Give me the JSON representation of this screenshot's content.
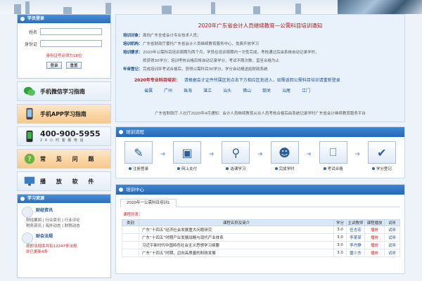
{
  "banner": {},
  "login": {
    "title": "学员登录",
    "name_label": "姓名",
    "id_label": "身份证",
    "name_value": "",
    "id_value": "",
    "hint": "身份证号必须为18位",
    "login_btn": "登录",
    "reset_btn": "重置"
  },
  "tiles": {
    "wechat": "手机微信学习指南",
    "app": "手机APP学习指南",
    "phone": "400-900-5955",
    "phone_sub": "2 4 小 时 客 服 电 话",
    "faq": "常 见 问 题",
    "player": "播 放 软 件"
  },
  "resources": {
    "title": "学习资源",
    "r1_title": "财经资讯",
    "r1_l1": "财经要闻 | 行业资讯 | 行业评论",
    "r1_l2": "税务资讯 | 海外动态 | 财税动态",
    "r2_title": "财会法规",
    "r2_l1": "现即法规库共有12247条法规",
    "r2_l2": "并已更新4条"
  },
  "notice": {
    "title": "2020年广东省会计人员继续教育—公需科目培训通知",
    "rows": [
      {
        "k": "培训对象：",
        "v": "面向广东全省会计专业技术人员；"
      },
      {
        "k": "培训机构：",
        "v": "广东省财政厅委托广东省会计人员继续教育服务中心，免费开放学习"
      },
      {
        "k": "培训要求：",
        "v": "2020年公需科目培训周期为两个月，学员在培训周期内一次性完成，考核通过后由系统自动记录学时，"
      },
      {
        "k": "",
        "v": "即获得30学分；培训考核合格后将自动记录学分，考试不限次数，直至合格为止"
      },
      {
        "k": "年审登记：",
        "v": "完成培训并考试合格后，获得公需科目30学分，学分自动报送给财政系统"
      }
    ],
    "alert": "2020年专业科目培训：",
    "alert_link": "请根据会计证件所属区划点击下方相应区划进入，如需返回公需科目培训请重新登录",
    "cities": [
      "省属",
      "广州",
      "珠海",
      "湛江",
      "汕头",
      "佛山",
      "韶关",
      "汕尾",
      "江门"
    ],
    "foot": "广东省财政厅·人社厅2020年4月通知：会计人员继续教育从业人员考核合格后由系统记录学时广东省会计继续教育服务平台"
  },
  "flow": {
    "title": "培训流程",
    "steps": [
      "注册登录",
      "网上支付",
      "选课学习",
      "完成学时",
      "考试合格",
      "学分登记"
    ]
  },
  "center": {
    "title": "培训中心",
    "tab": "2020年一公需科目培训1",
    "list_title": "课程列表：",
    "headers": [
      "类别",
      "课程名称及简介",
      "学分",
      "主讲教师",
      "课程播放",
      "试听"
    ],
    "rows": [
      {
        "name": "广东“十四五”经济社会发展重大问题研究",
        "credit": "3.0",
        "teacher": "任志宏",
        "play": "播放",
        "trial": "试听"
      },
      {
        "name": "广东“十四五”时期产业发展战略与现代产业体系",
        "credit": "3.0",
        "teacher": "李某某",
        "play": "播放",
        "trial": "试听"
      },
      {
        "name": "习近平新时代中国特色社会主义思想学习纲要",
        "credit": "3.0",
        "teacher": "李丹静",
        "play": "播放",
        "trial": "试听"
      },
      {
        "name": "广东“十四五”时期，迈向高质量的财政发展",
        "credit": "3.0",
        "teacher": "雷少杰",
        "play": "播放",
        "trial": "试听"
      }
    ]
  }
}
